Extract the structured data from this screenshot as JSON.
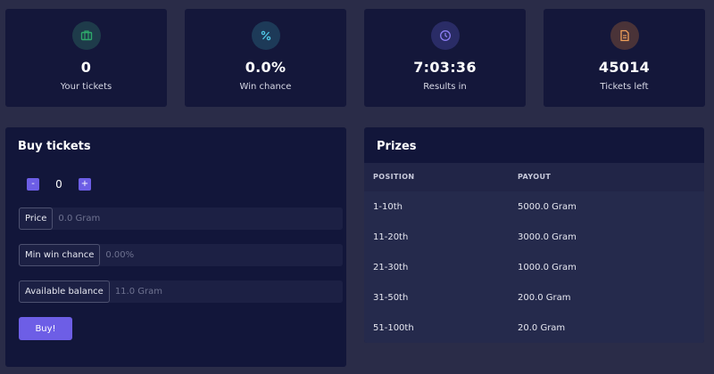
{
  "stats": [
    {
      "value": "0",
      "label": "Your tickets",
      "icon": "ticket-icon",
      "color": "#2ea86a",
      "bg": "#1e3b4a"
    },
    {
      "value": "0.0%",
      "label": "Win chance",
      "icon": "percent-icon",
      "color": "#4fc7e6",
      "bg": "#1d3a58"
    },
    {
      "value": "7:03:36",
      "label": "Results in",
      "icon": "clock-icon",
      "color": "#8b7df2",
      "bg": "#2a2c66"
    },
    {
      "value": "45014",
      "label": "Tickets left",
      "icon": "document-icon",
      "color": "#f0a05a",
      "bg": "#4a3338"
    }
  ],
  "buy": {
    "title": "Buy tickets",
    "minus": "-",
    "plus": "+",
    "quantity": "0",
    "price_label": "Price",
    "price_value": "0.0 Gram",
    "min_win_label": "Min win chance",
    "min_win_value": "0.00%",
    "balance_label": "Available balance",
    "balance_value": "11.0 Gram",
    "buy_label": "Buy!"
  },
  "prizes": {
    "title": "Prizes",
    "col_position": "POSITION",
    "col_payout": "PAYOUT",
    "rows": [
      {
        "position": "1-10th",
        "payout": "5000.0 Gram"
      },
      {
        "position": "11-20th",
        "payout": "3000.0 Gram"
      },
      {
        "position": "21-30th",
        "payout": "1000.0 Gram"
      },
      {
        "position": "31-50th",
        "payout": "200.0 Gram"
      },
      {
        "position": "51-100th",
        "payout": "20.0 Gram"
      }
    ]
  },
  "colors": {
    "accent": "#6d5ee6",
    "card": "#14173a",
    "background": "#2a2c48"
  }
}
